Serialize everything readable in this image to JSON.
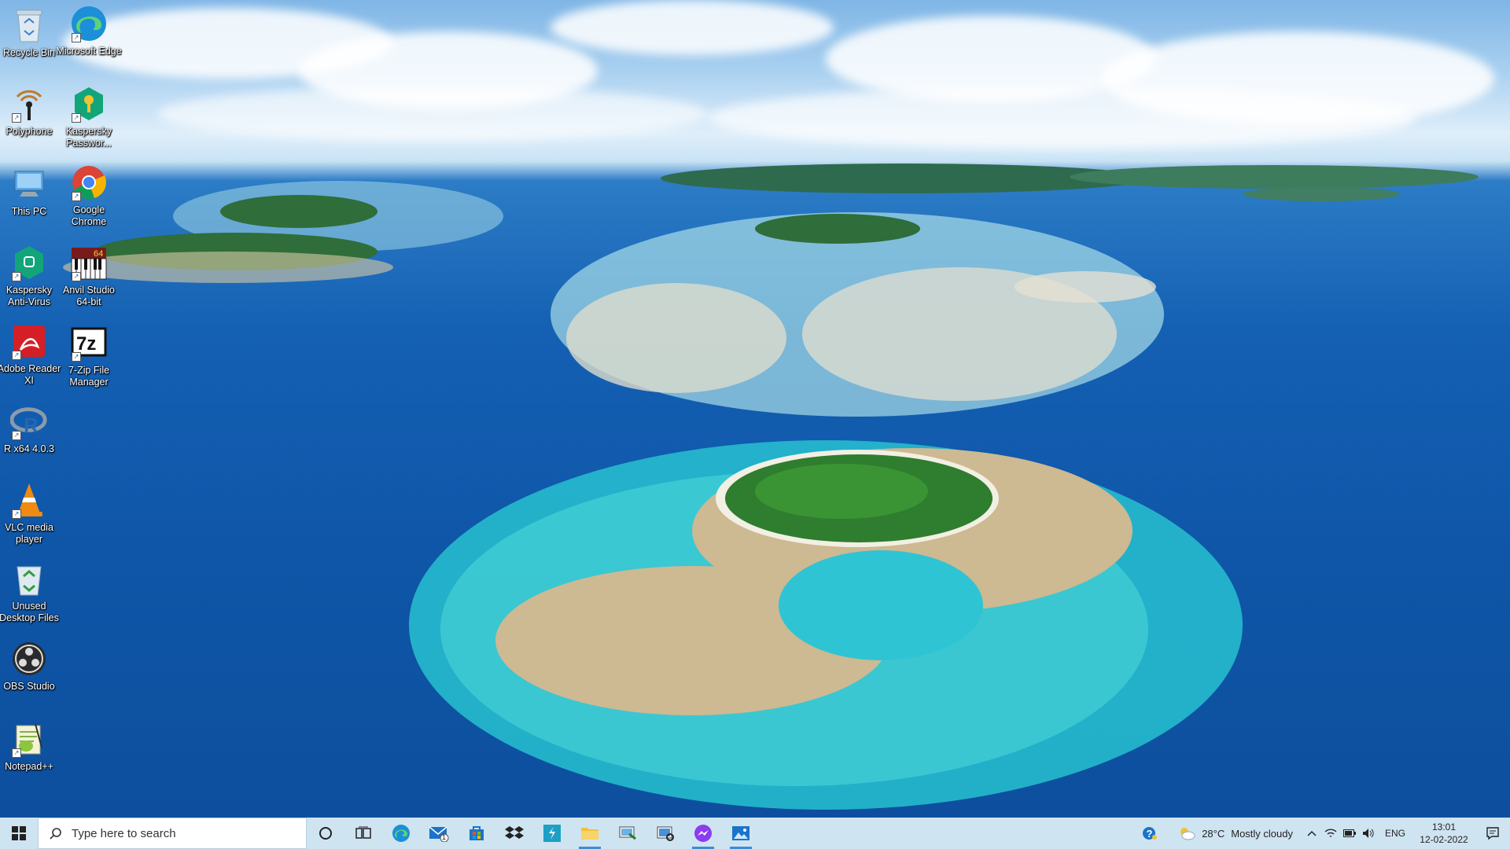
{
  "desktop": {
    "icons": [
      {
        "label": "Recycle Bin",
        "icon": "recycle-bin-icon"
      },
      {
        "label": "Microsoft Edge",
        "icon": "edge-icon"
      },
      {
        "label": "Polyphone",
        "icon": "polyphone-icon"
      },
      {
        "label": "Kaspersky Passwor...",
        "icon": "kaspersky-password-icon"
      },
      {
        "label": "This PC",
        "icon": "this-pc-icon"
      },
      {
        "label": "Google Chrome",
        "icon": "chrome-icon"
      },
      {
        "label": "Kaspersky Anti-Virus",
        "icon": "kaspersky-antivirus-icon"
      },
      {
        "label": "Anvil Studio 64-bit",
        "icon": "anvil-studio-icon"
      },
      {
        "label": "Adobe Reader XI",
        "icon": "adobe-reader-icon"
      },
      {
        "label": "7-Zip File Manager",
        "icon": "7zip-icon"
      },
      {
        "label": "R x64 4.0.3",
        "icon": "r-icon"
      },
      {
        "label": "VLC media player",
        "icon": "vlc-icon"
      },
      {
        "label": "Unused Desktop Files",
        "icon": "unused-files-icon"
      },
      {
        "label": "OBS Studio",
        "icon": "obs-icon"
      },
      {
        "label": "Notepad++",
        "icon": "notepadpp-icon"
      }
    ]
  },
  "taskbar": {
    "search_placeholder": "Type here to search",
    "pinned": [
      {
        "name": "cortana-icon"
      },
      {
        "name": "task-view-icon"
      },
      {
        "name": "edge-icon"
      },
      {
        "name": "mail-icon",
        "badge": "1"
      },
      {
        "name": "store-icon"
      },
      {
        "name": "dropbox-icon"
      },
      {
        "name": "sigma-app-icon"
      },
      {
        "name": "file-explorer-icon"
      },
      {
        "name": "remote-desktop-icon"
      },
      {
        "name": "snipping-tool-icon"
      },
      {
        "name": "messenger-icon"
      },
      {
        "name": "photos-icon"
      }
    ],
    "weather": {
      "temp": "28°C",
      "condition": "Mostly cloudy"
    },
    "language": "ENG",
    "time": "13:01",
    "date": "12-02-2022"
  },
  "colors": {
    "taskbar_bg": "#cfe4f1",
    "accent": "#3a8ed6"
  }
}
